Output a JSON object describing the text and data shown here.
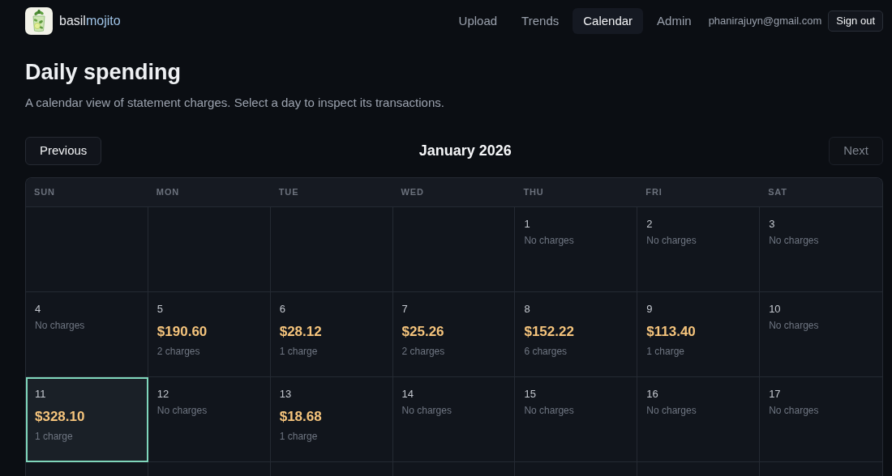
{
  "brand": {
    "name": "basil",
    "accent": "mojito"
  },
  "nav": {
    "links": [
      {
        "label": "Upload",
        "selected": false
      },
      {
        "label": "Trends",
        "selected": false
      },
      {
        "label": "Calendar",
        "selected": true
      },
      {
        "label": "Admin",
        "selected": false
      }
    ],
    "user_email": "phanirajuyn@gmail.com",
    "sign_out": "Sign out"
  },
  "page": {
    "title": "Daily spending",
    "subtitle": "A calendar view of statement charges. Select a day to inspect its transactions."
  },
  "month_nav": {
    "previous": {
      "label": "Previous",
      "disabled": false
    },
    "month": "January 2026",
    "next": {
      "label": "Next",
      "disabled": true
    }
  },
  "calendar": {
    "weekdays": [
      "SUN",
      "MON",
      "TUE",
      "WED",
      "THU",
      "FRI",
      "SAT"
    ],
    "weeks": [
      [
        {
          "kind": "empty"
        },
        {
          "kind": "empty"
        },
        {
          "kind": "empty"
        },
        {
          "kind": "empty"
        },
        {
          "kind": "uncharged",
          "day": "1",
          "note": "No charges",
          "selected": false
        },
        {
          "kind": "uncharged",
          "day": "2",
          "note": "No charges",
          "selected": false
        },
        {
          "kind": "uncharged",
          "day": "3",
          "note": "No charges",
          "selected": false
        }
      ],
      [
        {
          "kind": "uncharged",
          "day": "4",
          "note": "No charges",
          "selected": false
        },
        {
          "kind": "charged",
          "day": "5",
          "amount": "$190.60",
          "count": "2 charges",
          "selected": false
        },
        {
          "kind": "charged",
          "day": "6",
          "amount": "$28.12",
          "count": "1 charge",
          "selected": false
        },
        {
          "kind": "charged",
          "day": "7",
          "amount": "$25.26",
          "count": "2 charges",
          "selected": false
        },
        {
          "kind": "charged",
          "day": "8",
          "amount": "$152.22",
          "count": "6 charges",
          "selected": false
        },
        {
          "kind": "charged",
          "day": "9",
          "amount": "$113.40",
          "count": "1 charge",
          "selected": false
        },
        {
          "kind": "uncharged",
          "day": "10",
          "note": "No charges",
          "selected": false
        }
      ],
      [
        {
          "kind": "charged",
          "day": "11",
          "amount": "$328.10",
          "count": "1 charge",
          "selected": true
        },
        {
          "kind": "uncharged",
          "day": "12",
          "note": "No charges",
          "selected": false
        },
        {
          "kind": "charged",
          "day": "13",
          "amount": "$18.68",
          "count": "1 charge",
          "selected": false
        },
        {
          "kind": "uncharged",
          "day": "14",
          "note": "No charges",
          "selected": false
        },
        {
          "kind": "uncharged",
          "day": "15",
          "note": "No charges",
          "selected": false
        },
        {
          "kind": "uncharged",
          "day": "16",
          "note": "No charges",
          "selected": false
        },
        {
          "kind": "uncharged",
          "day": "17",
          "note": "No charges",
          "selected": false
        }
      ],
      [
        {
          "kind": "clipped"
        },
        {
          "kind": "clipped"
        },
        {
          "kind": "clipped"
        },
        {
          "kind": "clipped"
        },
        {
          "kind": "clipped"
        },
        {
          "kind": "clipped"
        },
        {
          "kind": "clipped"
        }
      ]
    ]
  }
}
